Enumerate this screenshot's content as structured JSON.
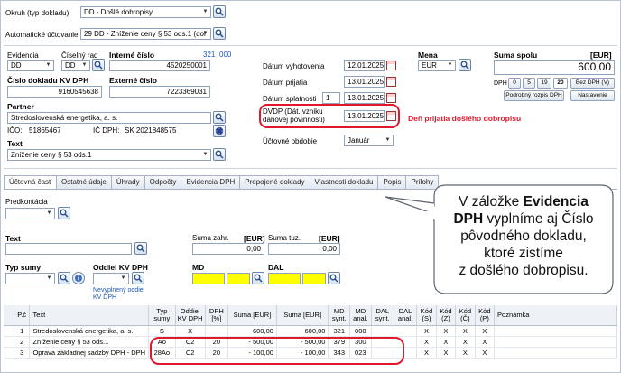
{
  "header": {
    "okruh_label": "Okruh (typ dokladu)",
    "okruh_value": "DD - Došlé dobropisy",
    "auto_label": "Automatické účtovanie",
    "auto_value": "29 DD - Zníženie  ceny § 53 ods.1 (dol"
  },
  "left": {
    "evidencia_label": "Evidencia",
    "evidencia_value": "DD",
    "ciselny_label": "Číselný rad",
    "ciselny_value": "DD",
    "interne_label": "Interné číslo",
    "interne_value": "4520250001",
    "range_a": "321",
    "range_b": "000",
    "cislo_kv_label": "Číslo dokladu KV DPH",
    "cislo_kv_value": "9160545638",
    "externe_label": "Externé číslo",
    "externe_value": "7223369031",
    "partner_label": "Partner",
    "partner_value": "Stredoslovenská energetika, a. s.",
    "ico_label": "IČO:",
    "ico_value": "51865467",
    "icdph_label": "IČ DPH:",
    "icdph_value": "SK 2021848575",
    "text_label": "Text",
    "text_value": "Zníženie  ceny § 53 ods.1"
  },
  "dates": {
    "vyhotovenia_label": "Dátum vyhotovenia",
    "vyhotovenia_value": "12.01.2025",
    "prijatia_label": "Dátum prijatia",
    "prijatia_value": "13.01.2025",
    "splatnosti_label": "Dátum splatnosti",
    "splatnosti_days": "1",
    "splatnosti_value": "13.01.2025",
    "dvdp_label_1": "DVDP (Dát. vzniku",
    "dvdp_label_2": "daňovej povinnosti)",
    "dvdp_value": "13.01.2025",
    "obdobie_label": "Účtovné obdobie",
    "obdobie_value": "Január",
    "annotation": "Deň prijatia došlého dobropisu"
  },
  "right": {
    "mena_label": "Mena",
    "mena_value": "EUR",
    "suma_label": "Suma spolu",
    "suma_unit": "[EUR]",
    "suma_value": "600,00",
    "dph_label": "DPH",
    "rates": [
      "0",
      "5",
      "19",
      "20"
    ],
    "bez_dph": "Bez DPH (V)",
    "podrobny": "Podrobný rozpis DPH",
    "nastavenie": "Nastavenie"
  },
  "tabs": [
    "Účtovná časť",
    "Ostatné údaje",
    "Úhrady",
    "Odpočty",
    "Evidencia DPH",
    "Prepojené doklady",
    "Vlastnosti dokladu",
    "Popis",
    "Prílohy"
  ],
  "accounting": {
    "predkontacia_label": "Predkontácia",
    "text_label": "Text",
    "suma_zahr_label": "Suma zahr.",
    "eur_1": "[EUR]",
    "suma_zahr_value": "0,00",
    "suma_tuz_label": "Suma tuz.",
    "eur_2": "[EUR]",
    "suma_tuz_value": "0,00",
    "typ_sumy_label": "Typ sumy",
    "oddiel_label": "Oddiel KV DPH",
    "nevyplneny_1": "Nevyplnený oddiel",
    "nevyplneny_2": "KV DPH",
    "md_label": "MD",
    "dal_label": "DAL"
  },
  "callout": {
    "line1_pre": "V záložke ",
    "line1_bold": "Evidencia",
    "line2_bold": "DPH",
    "line2_post": " vyplníme aj Číslo",
    "line3": "pôvodného dokladu,",
    "line4": "ktoré zistíme",
    "line5": "z došlého dobropisu."
  },
  "grid": {
    "columns": [
      "P.č",
      "Text",
      "Typ sumy",
      "Oddiel KV DPH",
      "DPH [%]",
      "Suma [EUR]",
      "Suma [EUR]",
      "MD synt.",
      "MD anal.",
      "DAL synt.",
      "DAL anal.",
      "Kód (S)",
      "Kód (Z)",
      "Kód (Č)",
      "Kód (P)",
      "Poznámka"
    ],
    "rows": [
      [
        "1",
        "Stredoslovenská energetika, a. s.",
        "S",
        "X",
        "",
        "600,00",
        "600,00",
        "321",
        "000",
        "",
        "",
        "X",
        "X",
        "X",
        "X",
        ""
      ],
      [
        "2",
        "Zníženie  ceny § 53 ods.1",
        "Ao",
        "C2",
        "20",
        "- 500,00",
        "- 500,00",
        "379",
        "300",
        "",
        "",
        "X",
        "X",
        "X",
        "X",
        ""
      ],
      [
        "3",
        "Oprava základnej sadzby DPH - DPH",
        "28Ao",
        "C2",
        "20",
        "- 100,00",
        "- 100,00",
        "343",
        "023",
        "",
        "",
        "X",
        "X",
        "X",
        "X",
        ""
      ]
    ]
  },
  "colors": {
    "annotation_red": "#e0182c",
    "field_yellow": "#ffff00",
    "link_blue": "#1a56b5"
  }
}
